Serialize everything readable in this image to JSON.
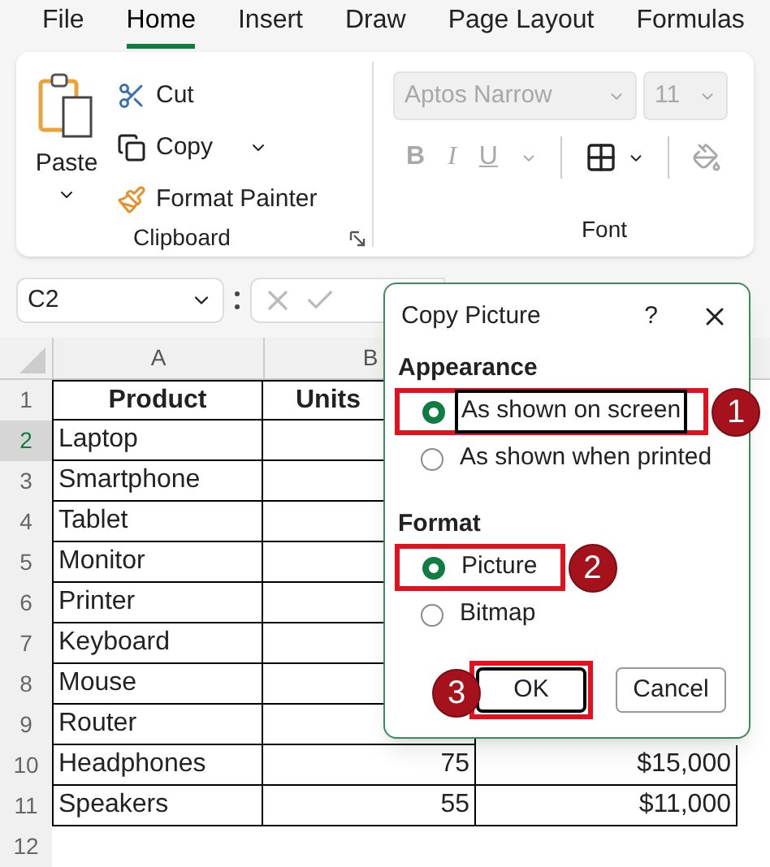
{
  "menu_tabs": [
    {
      "label": "File",
      "selected": false
    },
    {
      "label": "Home",
      "selected": true
    },
    {
      "label": "Insert",
      "selected": false
    },
    {
      "label": "Draw",
      "selected": false
    },
    {
      "label": "Page Layout",
      "selected": false
    },
    {
      "label": "Formulas",
      "selected": false
    }
  ],
  "ribbon": {
    "clipboard": {
      "paste": "Paste",
      "cut": "Cut",
      "copy": "Copy",
      "format_painter": "Format Painter",
      "group_label": "Clipboard"
    },
    "font": {
      "disabled": true,
      "font_name": "Aptos Narrow",
      "font_size": "11",
      "bold": "B",
      "italic": "I",
      "underline": "U",
      "group_label": "Font"
    }
  },
  "formula_bar": {
    "name_box": "C2"
  },
  "sheet": {
    "columns": [
      "A",
      "B"
    ],
    "headers": [
      "Product",
      "Units"
    ],
    "header_row": {
      "number": "1",
      "selected": false
    },
    "rows": [
      {
        "number": "2",
        "selected": true,
        "product": "Laptop"
      },
      {
        "number": "3",
        "selected": false,
        "product": "Smartphone"
      },
      {
        "number": "4",
        "selected": false,
        "product": "Tablet"
      },
      {
        "number": "5",
        "selected": false,
        "product": "Monitor"
      },
      {
        "number": "6",
        "selected": false,
        "product": "Printer"
      },
      {
        "number": "7",
        "selected": false,
        "product": "Keyboard"
      },
      {
        "number": "8",
        "selected": false,
        "product": "Mouse"
      },
      {
        "number": "9",
        "selected": false,
        "product": "Router"
      },
      {
        "number": "10",
        "selected": false,
        "product": "Headphones",
        "units": "75",
        "revenue": "$15,000"
      },
      {
        "number": "11",
        "selected": false,
        "product": "Speakers",
        "units": "55",
        "revenue": "$11,000"
      },
      {
        "number": "12",
        "selected": false
      }
    ]
  },
  "dialog": {
    "title": "Copy Picture",
    "help": "?",
    "sections": [
      {
        "heading": "Appearance",
        "options": [
          {
            "label": "As shown on screen",
            "selected": true,
            "focused": true,
            "step": "1"
          },
          {
            "label": "As shown when printed",
            "selected": false,
            "focused": false
          }
        ]
      },
      {
        "heading": "Format",
        "options": [
          {
            "label": "Picture",
            "selected": true,
            "focused": false,
            "step": "2"
          },
          {
            "label": "Bitmap",
            "selected": false,
            "focused": false
          }
        ]
      }
    ],
    "buttons": [
      {
        "label": "OK",
        "default": true,
        "step": "3"
      },
      {
        "label": "Cancel",
        "default": false
      }
    ]
  }
}
